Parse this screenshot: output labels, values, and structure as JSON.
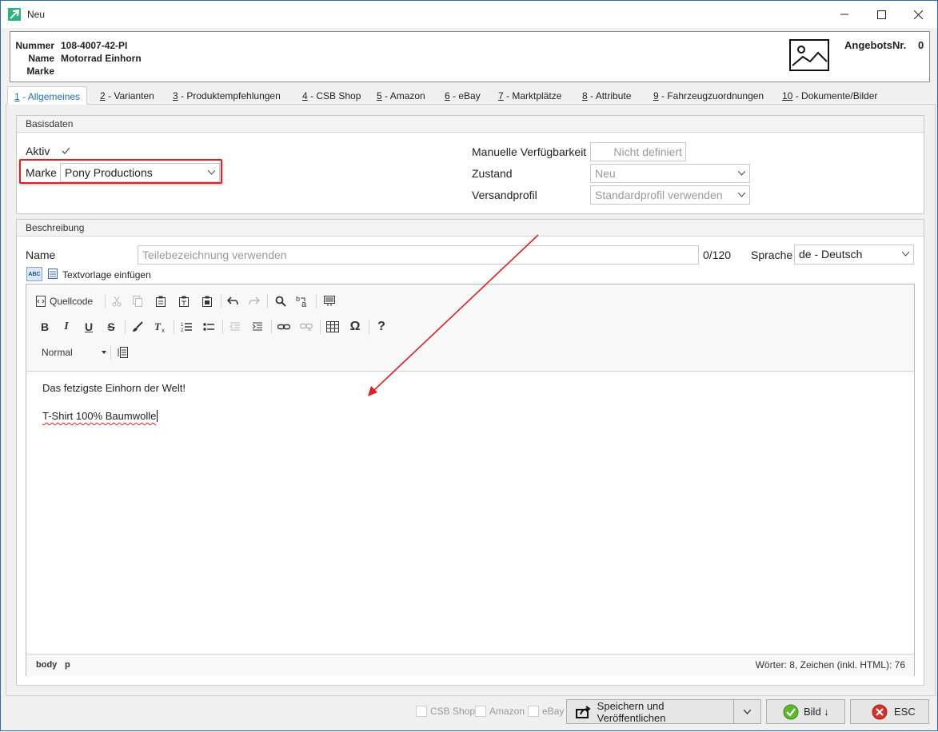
{
  "window": {
    "title": "Neu"
  },
  "header": {
    "nummer_label": "Nummer",
    "nummer_value": "108-4007-42-PI",
    "name_label": "Name",
    "name_value": "Motorrad Einhorn",
    "marke_label": "Marke",
    "marke_value": "",
    "angebot_label": "AngebotsNr.",
    "angebot_value": "0"
  },
  "tabs": [
    {
      "key": "1",
      "label": " - Allgemeines",
      "active": true
    },
    {
      "key": "2",
      "label": " - Varianten"
    },
    {
      "key": "3",
      "label": " - Produktempfehlungen"
    },
    {
      "key": "4",
      "label": " - CSB Shop"
    },
    {
      "key": "5",
      "label": " - Amazon"
    },
    {
      "key": "6",
      "label": " - eBay"
    },
    {
      "key": "7",
      "label": " - Marktplätze"
    },
    {
      "key": "8",
      "label": " - Attribute"
    },
    {
      "key": "9",
      "label": " - Fahrzeugzuordnungen"
    },
    {
      "key": "10",
      "label": " - Dokumente/Bilder"
    }
  ],
  "basisdaten": {
    "title": "Basisdaten",
    "aktiv_label": "Aktiv",
    "aktiv_checked": true,
    "marke_label": "Marke",
    "marke_value": "Pony Productions",
    "verfuegbarkeit_label": "Manuelle Verfügbarkeit",
    "verfuegbarkeit_value": "Nicht definiert",
    "zustand_label": "Zustand",
    "zustand_value": "Neu",
    "versandprofil_label": "Versandprofil",
    "versandprofil_value": "Standardprofil verwenden"
  },
  "beschreibung": {
    "title": "Beschreibung",
    "name_label": "Name",
    "name_placeholder": "Teilebezeichnung verwenden",
    "counter": "0/120",
    "sprache_label": "Sprache",
    "sprache_value": "de - Deutsch",
    "abc_label": "ABC",
    "textvorlage_label": "Textvorlage einfügen"
  },
  "editor": {
    "quellcode_label": "Quellcode",
    "format_value": "Normal",
    "bold": "B",
    "italic": "I",
    "underline": "U",
    "strike": "S",
    "omega": "Ω",
    "help": "?",
    "paragraphs": [
      "Das fetzigste Einhorn der Welt!",
      "T-Shirt 100% Baumwolle"
    ],
    "path_body": "body",
    "path_p": "p",
    "wordcount": "Wörter: 8, Zeichen (inkl. HTML): 76"
  },
  "footer": {
    "csb_label": "CSB Shop",
    "amazon_label": "Amazon",
    "ebay_label": "eBay",
    "publish_label": "Speichern und Veröffentlichen",
    "bild_label": "Bild ↓",
    "esc_label": "ESC"
  },
  "colors": {
    "accent": "#1a6fc4",
    "highlight": "#e12024",
    "arrow": "#e12024"
  }
}
